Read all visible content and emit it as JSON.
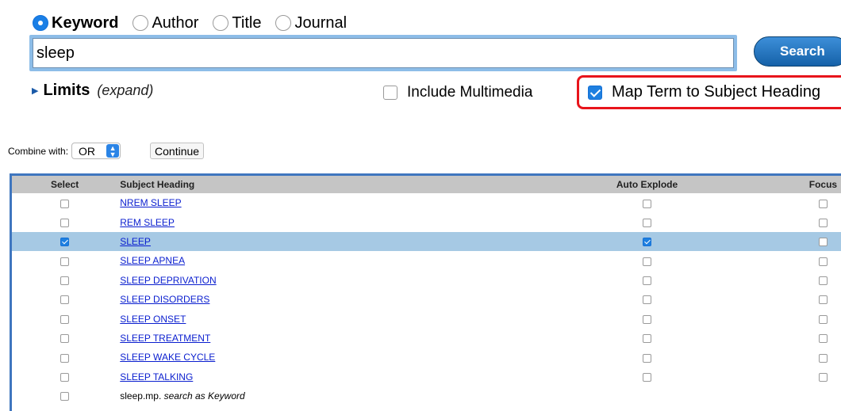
{
  "search_types": [
    {
      "label": "Keyword",
      "checked": true
    },
    {
      "label": "Author",
      "checked": false
    },
    {
      "label": "Title",
      "checked": false
    },
    {
      "label": "Journal",
      "checked": false
    }
  ],
  "query": {
    "value": "sleep"
  },
  "search_button": "Search",
  "limits": {
    "label": "Limits",
    "expand": "(expand)"
  },
  "include_multimedia": {
    "label": "Include Multimedia",
    "checked": false
  },
  "map_term": {
    "label": "Map Term to Subject Heading",
    "checked": true
  },
  "combine": {
    "label": "Combine with:",
    "selected": "OR",
    "continue_label": "Continue"
  },
  "table": {
    "headers": {
      "select": "Select",
      "subject": "Subject Heading",
      "auto_explode": "Auto Explode",
      "focus": "Focus"
    },
    "rows": [
      {
        "heading": "NREM SLEEP",
        "selected": false,
        "auto_explode": false,
        "focus": false
      },
      {
        "heading": "REM SLEEP",
        "selected": false,
        "auto_explode": false,
        "focus": false
      },
      {
        "heading": "SLEEP",
        "selected": true,
        "auto_explode": true,
        "focus": false
      },
      {
        "heading": "SLEEP APNEA",
        "selected": false,
        "auto_explode": false,
        "focus": false
      },
      {
        "heading": "SLEEP DEPRIVATION",
        "selected": false,
        "auto_explode": false,
        "focus": false
      },
      {
        "heading": "SLEEP DISORDERS",
        "selected": false,
        "auto_explode": false,
        "focus": false
      },
      {
        "heading": "SLEEP ONSET",
        "selected": false,
        "auto_explode": false,
        "focus": false
      },
      {
        "heading": "SLEEP TREATMENT",
        "selected": false,
        "auto_explode": false,
        "focus": false
      },
      {
        "heading": "SLEEP WAKE CYCLE",
        "selected": false,
        "auto_explode": false,
        "focus": false
      },
      {
        "heading": "SLEEP TALKING",
        "selected": false,
        "auto_explode": false,
        "focus": false
      }
    ],
    "keyword_row": {
      "term": "sleep.mp.",
      "note": "search as Keyword"
    }
  }
}
